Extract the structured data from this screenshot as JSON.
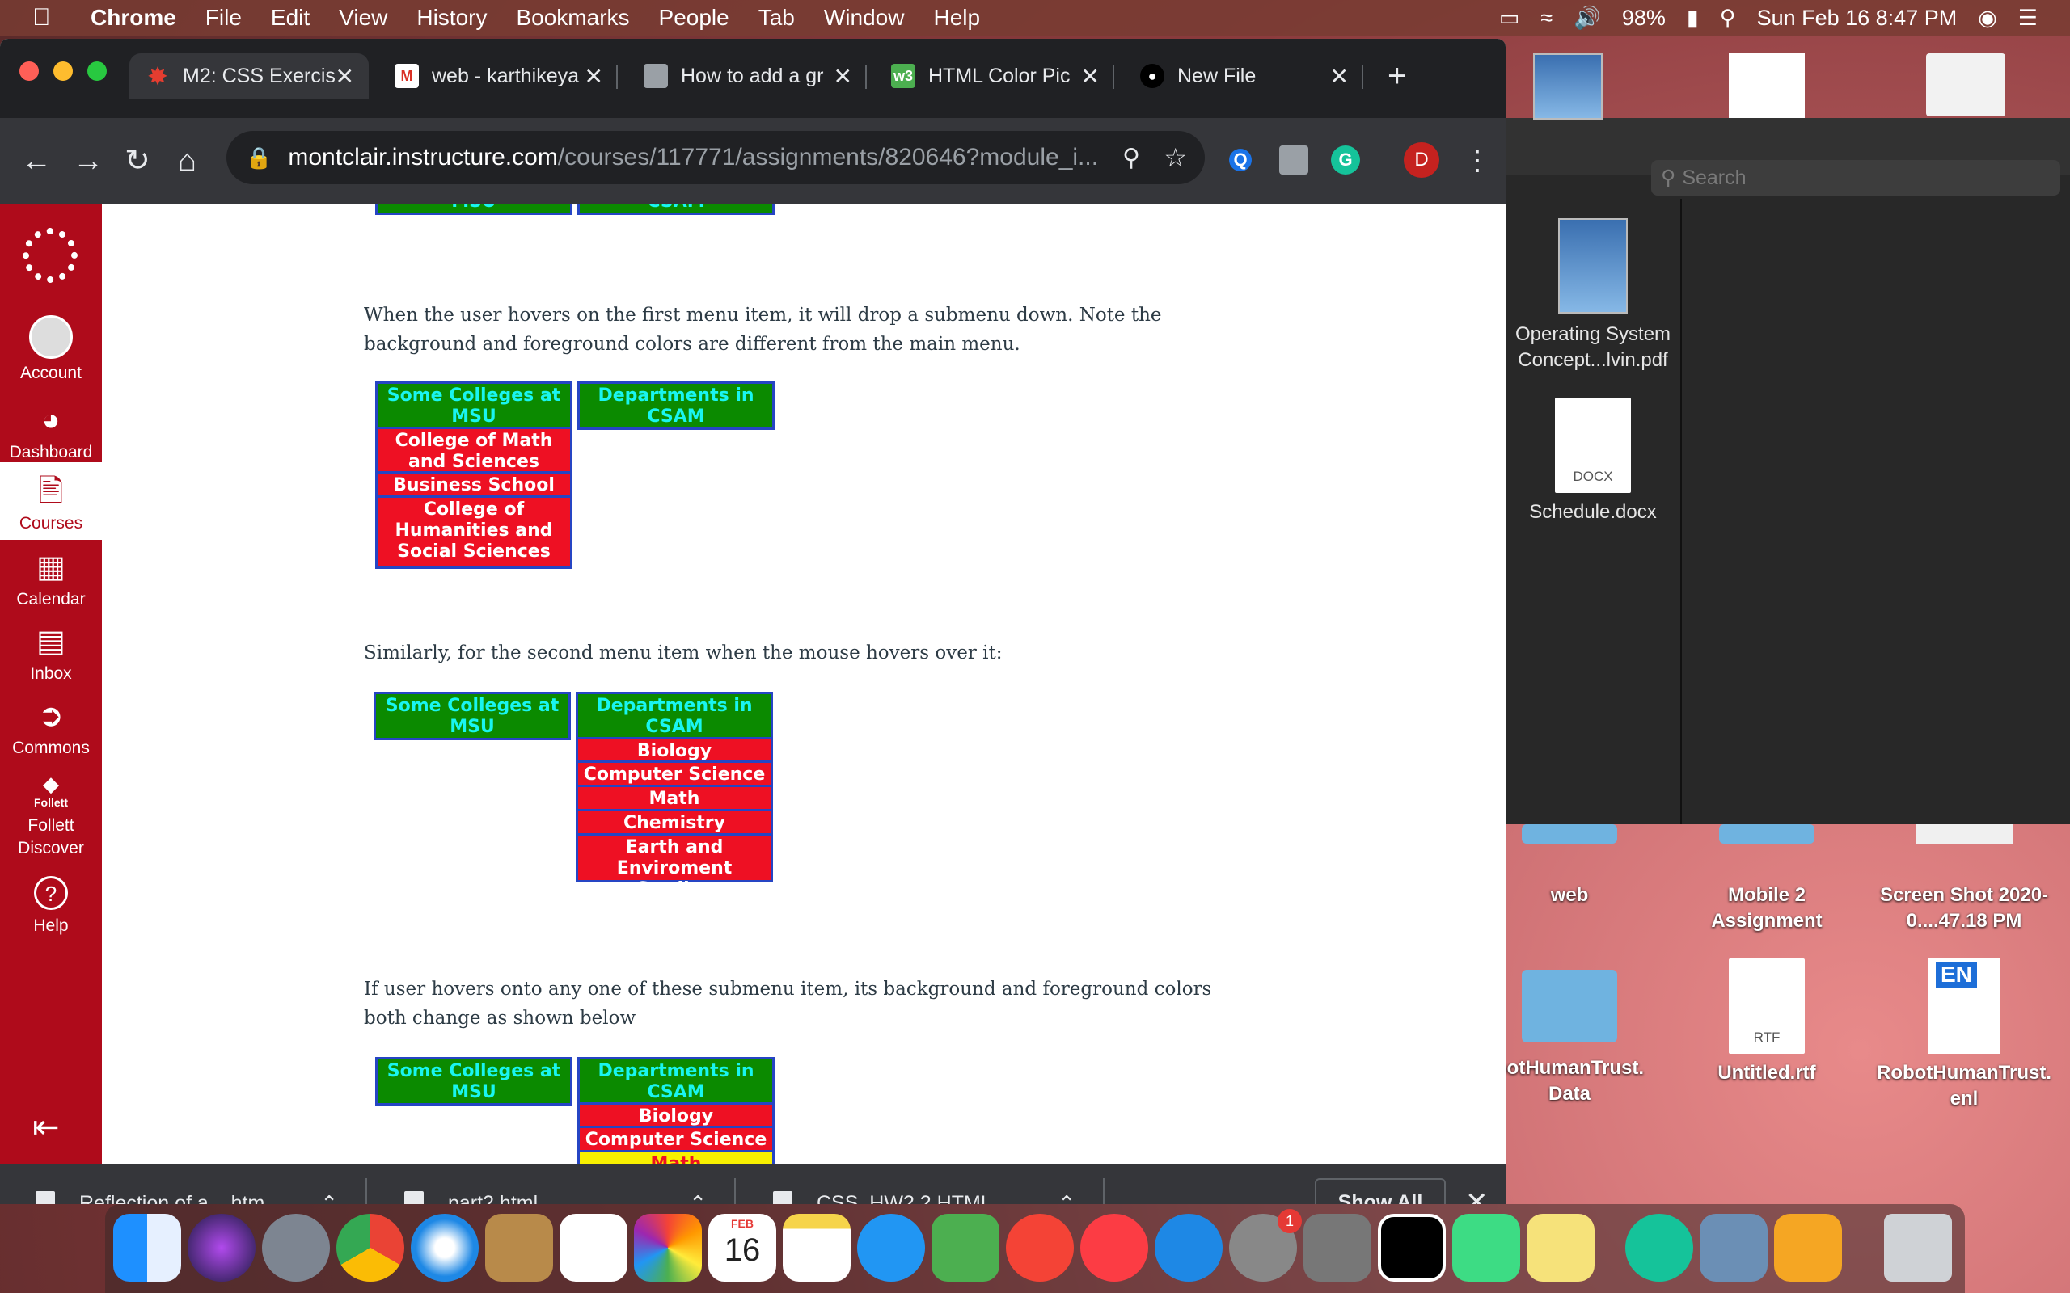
{
  "menubar": {
    "app": "Chrome",
    "items": [
      "File",
      "Edit",
      "View",
      "History",
      "Bookmarks",
      "People",
      "Tab",
      "Window",
      "Help"
    ],
    "battery": "98%",
    "datetime": "Sun Feb 16  8:47 PM"
  },
  "tabs": [
    {
      "label": "M2: CSS Exercis",
      "icon": "canvas-icon",
      "active": true
    },
    {
      "label": "web - karthikeya",
      "icon": "gmail-icon",
      "active": false
    },
    {
      "label": "How to add a gr",
      "icon": "page-icon",
      "active": false
    },
    {
      "label": "HTML Color Pic",
      "icon": "w3schools-icon",
      "active": false
    },
    {
      "label": "New File",
      "icon": "github-icon",
      "active": false
    }
  ],
  "omnibox": {
    "host": "montclair.instructure.com",
    "path": "/courses/117771/assignments/820646?module_i..."
  },
  "profile_initial": "D",
  "canvas_nav": [
    {
      "label": "Account",
      "icon": "account-icon"
    },
    {
      "label": "Dashboard",
      "icon": "dashboard-icon"
    },
    {
      "label": "Courses",
      "icon": "courses-icon",
      "active": true
    },
    {
      "label": "Calendar",
      "icon": "calendar-icon"
    },
    {
      "label": "Inbox",
      "icon": "inbox-icon"
    },
    {
      "label": "Commons",
      "icon": "commons-icon"
    },
    {
      "label": "Follett Discover",
      "icon": "follett-icon",
      "small": "Follett"
    },
    {
      "label": "Help",
      "icon": "help-icon"
    }
  ],
  "content": {
    "para1": "When the user hovers on the first menu item, it will drop a submenu down. Note the background and foreground colors are different from the main menu.",
    "para2": "Similarly, for the second menu item when the mouse hovers over it:",
    "para3": "If user hovers onto any one of these submenu item, its background and foreground colors both change as shown below",
    "menu1": "Some Colleges at MSU",
    "menu2": "Departments in CSAM",
    "colleges": [
      "College of Math and Sciences",
      "Business School",
      "College of Humanities and Social Sciences"
    ],
    "departments": [
      "Biology",
      "Computer Science",
      "Math",
      "Chemistry",
      "Earth and Enviroment Studies"
    ],
    "top_cut": [
      "MSU",
      "CSAM"
    ]
  },
  "downloads": [
    {
      "name": "Reflection of a....htm"
    },
    {
      "name": "part2.html"
    },
    {
      "name": "CSS_HW2.2.HTML"
    }
  ],
  "shelf": {
    "show_all": "Show All"
  },
  "finder": {
    "search_placeholder": "Search",
    "items": [
      {
        "name": "Operating System Concept...lvin.pdf"
      },
      {
        "name": "Schedule.docx",
        "type": "DOCX"
      }
    ]
  },
  "desktop": [
    {
      "name": "web"
    },
    {
      "name": "Mobile 2 Assignment"
    },
    {
      "name": "Screen Shot 2020-0....47.18 PM"
    },
    {
      "name": "botHumanTrust. Data"
    },
    {
      "name": "Untitled.rtf",
      "type": "RTF"
    },
    {
      "name": "RobotHumanTrust. enl",
      "badge": "EN"
    }
  ],
  "dock": {
    "calendar_month": "FEB",
    "calendar_day": "16",
    "badge": "1"
  },
  "colors": {
    "canvas_red": "#af0b1b",
    "menu_green": "#0b8a00",
    "menu_text": "#19f5f0",
    "submenu_red": "#ee1023",
    "hover_yellow": "#f8f000",
    "border_blue": "#2645c4"
  }
}
